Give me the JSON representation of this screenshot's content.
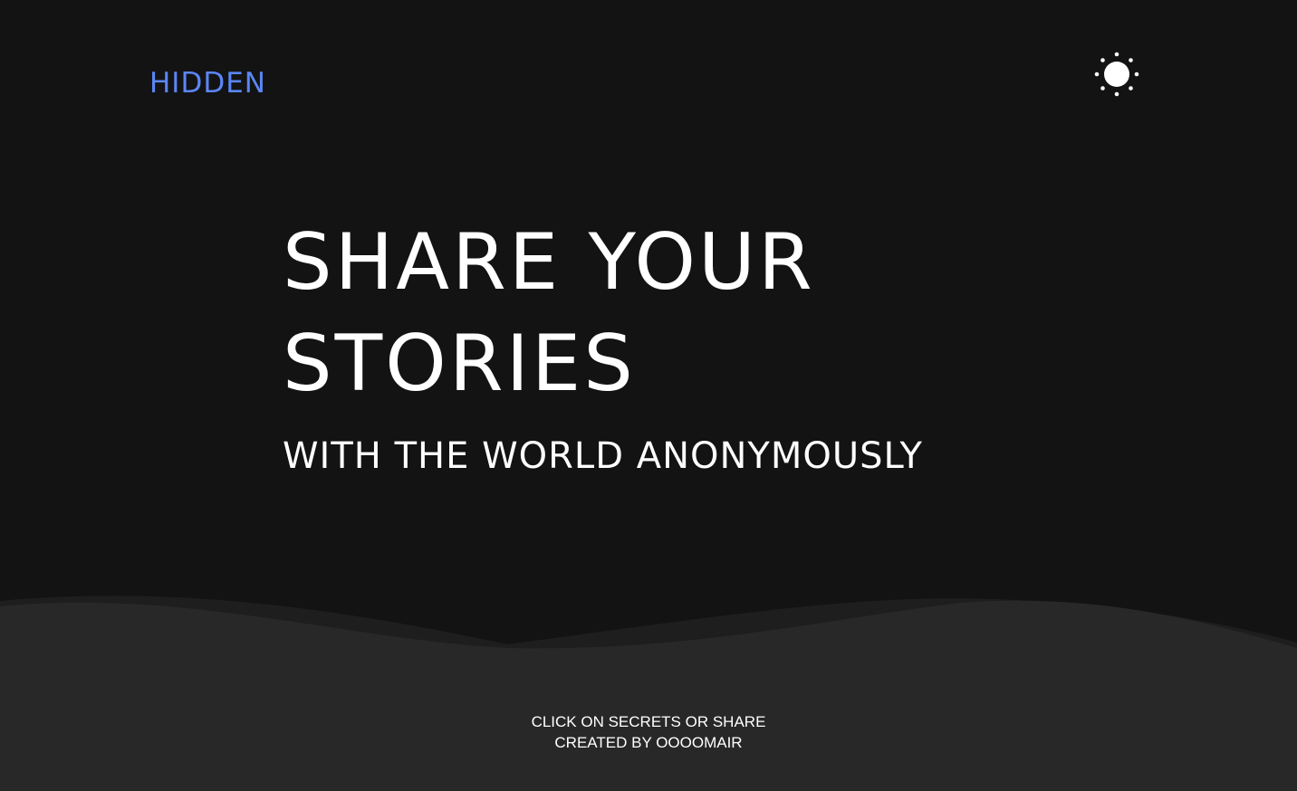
{
  "header": {
    "logo_text": "HIDDEN",
    "theme_toggle_icon": "sun-icon"
  },
  "hero": {
    "line1": "SHARE YOUR",
    "line2": "STORIES",
    "subtitle": "WITH THE WORLD ANONYMOUSLY"
  },
  "footer": {
    "line1": "CLICK ON SECRETS OR SHARE",
    "line2": "CREATED BY OOOOMAIR"
  },
  "colors": {
    "background": "#131313",
    "wave_back": "#1e1e1e",
    "wave_front": "#282828",
    "accent": "#5b86f5",
    "text": "#ffffff"
  }
}
